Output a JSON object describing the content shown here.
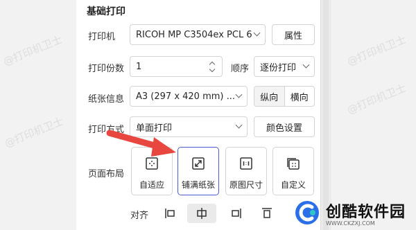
{
  "section": {
    "title": "基础打印"
  },
  "printer": {
    "label": "打印机",
    "value": "RICOH MP C3504ex PCL 6",
    "props_button": "属性"
  },
  "copies": {
    "label": "打印份数",
    "value": "1",
    "order_label": "顺序",
    "order_value": "逐份打印"
  },
  "paper": {
    "label": "纸张信息",
    "value": "A3 (297 x 420 mm) ...",
    "orientation": [
      "纵向",
      "横向"
    ],
    "selected_orientation": "纵向"
  },
  "print_mode": {
    "label": "打印方式",
    "value": "单面打印",
    "color_button": "颜色设置"
  },
  "page_layout": {
    "label": "页面布局",
    "options": [
      {
        "label": "自适应",
        "icon": "fit-icon"
      },
      {
        "label": "铺满纸张",
        "icon": "expand-icon"
      },
      {
        "label": "原图尺寸",
        "icon": "original-size-icon"
      },
      {
        "label": "自定义",
        "icon": "custom-icon"
      }
    ],
    "selected": "铺满纸张"
  },
  "alignment": {
    "label": "对齐",
    "selected": "align-center"
  },
  "watermark": "@打印机卫士",
  "brand": {
    "name": "创酷软件园",
    "url": "WWW.CKZXJ.COM"
  },
  "colors": {
    "accent": "#4a5bd0",
    "arrow": "#e8473f",
    "brand_blue": "#2b6fe8",
    "brand_cyan": "#2fc6c6"
  }
}
